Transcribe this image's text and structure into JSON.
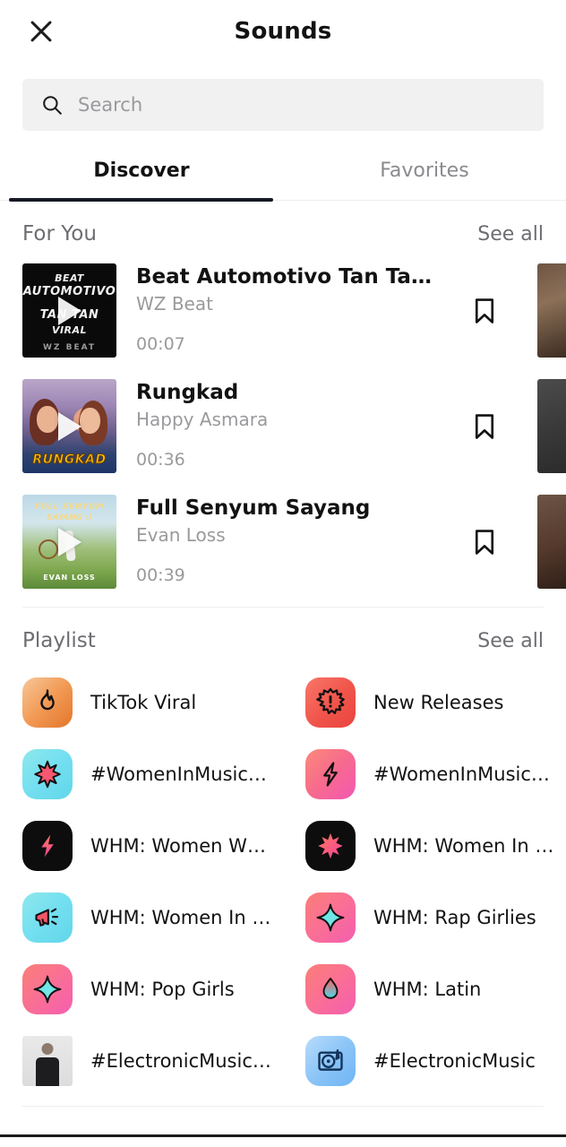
{
  "header": {
    "title": "Sounds",
    "close_icon": "close-icon"
  },
  "search": {
    "placeholder": "Search",
    "value": "",
    "icon": "search-icon"
  },
  "tabs": [
    {
      "label": "Discover",
      "active": true
    },
    {
      "label": "Favorites",
      "active": false
    }
  ],
  "for_you": {
    "title": "For You",
    "see_all_label": "See all",
    "sounds": [
      {
        "title": "Beat Automotivo Tan Tan T...",
        "artist": "WZ Beat",
        "duration": "00:07",
        "bookmark_icon": "bookmark-icon",
        "cover_lines": [
          "BEAT",
          "AUTOMOTIVO",
          "TAN  TAN",
          "VIRAL",
          "WZ BEAT"
        ]
      },
      {
        "title": "Rungkad",
        "artist": "Happy Asmara",
        "duration": "00:36",
        "bookmark_icon": "bookmark-icon",
        "cover_label": "RUNGKAD"
      },
      {
        "title": "Full Senyum Sayang",
        "artist": "Evan Loss",
        "duration": "00:39",
        "bookmark_icon": "bookmark-icon",
        "cover_title": "FULL SENYUM",
        "cover_title2": "SAYANG :)",
        "cover_credit": "EVAN LOSS"
      }
    ]
  },
  "playlist": {
    "title": "Playlist",
    "see_all_label": "See all",
    "items": [
      {
        "label": "TikTok Viral",
        "icon": "flame-icon",
        "style": "g-orange"
      },
      {
        "label": "New Releases",
        "icon": "burst-alert-icon",
        "style": "g-red"
      },
      {
        "label": "#WomenInMusic x Ke...",
        "icon": "starburst-icon",
        "style": "g-cyan"
      },
      {
        "label": "#WomenInMusic x Ki...",
        "icon": "bolt-icon",
        "style": "g-pinkred"
      },
      {
        "label": "WHM: Women Who Rock",
        "icon": "bolt-icon",
        "style": "g-black"
      },
      {
        "label": "WHM: Women In RnB",
        "icon": "starburst-icon",
        "style": "g-black"
      },
      {
        "label": "WHM: Women In Coun...",
        "icon": "megaphone-icon",
        "style": "g-cyan"
      },
      {
        "label": "WHM: Rap Girlies",
        "icon": "sparkle-icon",
        "style": "g-pink"
      },
      {
        "label": "WHM: Pop Girls",
        "icon": "sparkle-icon",
        "style": "g-pink"
      },
      {
        "label": "WHM: Latin",
        "icon": "droplet-icon",
        "style": "g-pink"
      },
      {
        "label": "#ElectronicMusic x S...",
        "icon": "person-photo",
        "style": "g-photo"
      },
      {
        "label": "#ElectronicMusic",
        "icon": "turntable-icon",
        "style": "g-blue"
      }
    ]
  },
  "colors": {
    "accent": "#161823",
    "text_primary": "#121212",
    "text_muted": "#9a9a9d",
    "search_bg": "#f1f1f2"
  }
}
